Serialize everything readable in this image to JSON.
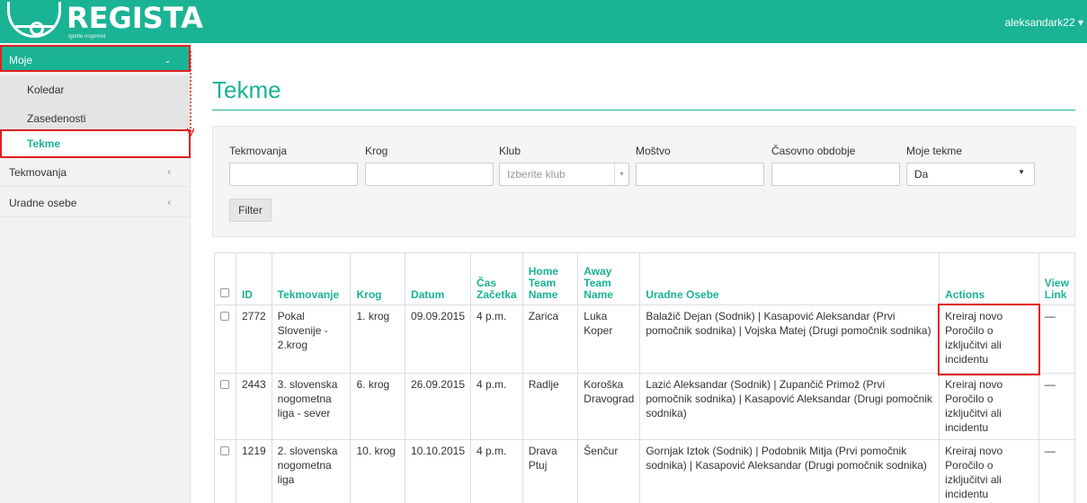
{
  "header": {
    "logo_text": "REGISTA",
    "logo_sub": "igorite nogomet",
    "user": "aleksandark22"
  },
  "sidebar": {
    "items": [
      {
        "label": "Moje"
      },
      {
        "label": "Koledar"
      },
      {
        "label": "Zasedenosti"
      },
      {
        "label": "Tekme"
      },
      {
        "label": "Tekmovanja"
      },
      {
        "label": "Uradne osebe"
      }
    ]
  },
  "page": {
    "title": "Tekme"
  },
  "filters": {
    "labels": {
      "tekmovanja": "Tekmovanja",
      "krog": "Krog",
      "klub": "Klub",
      "mostvo": "Moštvo",
      "obdobje": "Časovno obdobje",
      "moje": "Moje tekme"
    },
    "klub_placeholder": "Izberite klub",
    "moje_value": "Da",
    "button": "Filter"
  },
  "table": {
    "headers": {
      "id": "ID",
      "tekmovanje": "Tekmovanje",
      "krog": "Krog",
      "datum": "Datum",
      "cas_1": "Čas",
      "cas_2": "Začetka",
      "home_1": "Home",
      "home_2": "Team",
      "home_3": "Name",
      "away_1": "Away",
      "away_2": "Team",
      "away_3": "Name",
      "uradne": "Uradne Osebe",
      "actions": "Actions",
      "view_1": "View",
      "view_2": "Link"
    },
    "rows": [
      {
        "id": "2772",
        "tekmovanje": "Pokal Slovenije - 2.krog",
        "krog": "1. krog",
        "datum": "09.09.2015",
        "cas": "4 p.m.",
        "home": "Zarica",
        "away": "Luka Koper",
        "uradne": "Balažič Dejan (Sodnik) | Kasapović Aleksandar (Prvi pomočnik sodnika) | Vojska Matej (Drugi pomočnik sodnika)",
        "action": "Kreiraj novo Poročilo o izključitvi ali incidentu",
        "view": "—"
      },
      {
        "id": "2443",
        "tekmovanje": "3. slovenska nogometna liga - sever",
        "krog": "6. krog",
        "datum": "26.09.2015",
        "cas": "4 p.m.",
        "home": "Radlje",
        "away": "Koroška Dravograd",
        "uradne": "Lazić Aleksandar (Sodnik) | Zupančič Primož (Prvi pomočnik sodnika) | Kasapović Aleksandar (Drugi pomočnik sodnika)",
        "action": "Kreiraj novo Poročilo o izključitvi ali incidentu",
        "view": "—"
      },
      {
        "id": "1219",
        "tekmovanje": "2. slovenska nogometna liga",
        "krog": "10. krog",
        "datum": "10.10.2015",
        "cas": "4 p.m.",
        "home": "Drava Ptuj",
        "away": "Šenčur",
        "uradne": "Gornjak Iztok (Sodnik) | Podobnik Mitja (Prvi pomočnik sodnika) | Kasapović Aleksandar (Drugi pomočnik sodnika)",
        "action": "Kreiraj novo Poročilo o izključitvi ali incidentu",
        "view": "—"
      }
    ]
  },
  "colors": {
    "accent": "#1ab394",
    "highlight": "#e02020"
  },
  "icons": {
    "expand": "chevron-down-icon",
    "collapse": "chevron-left-icon",
    "user_caret": "caret-down-icon"
  }
}
